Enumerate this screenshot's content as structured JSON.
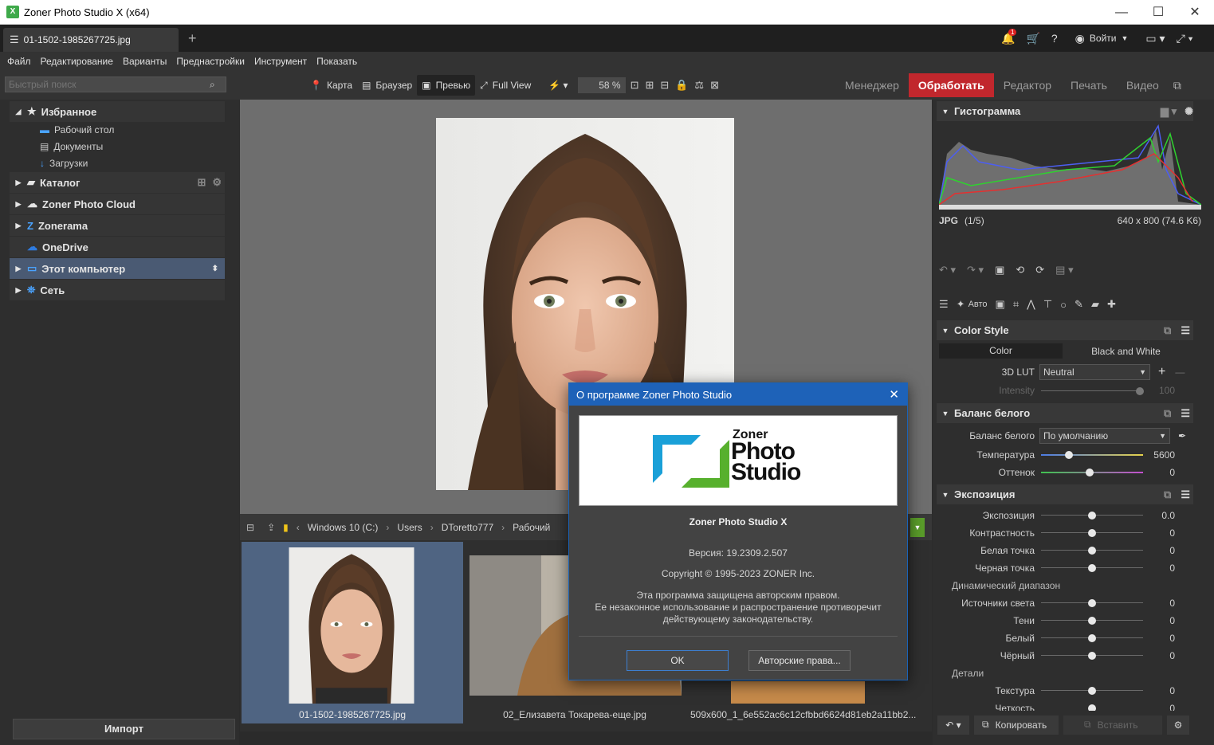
{
  "window": {
    "title": "Zoner Photo Studio X (x64)",
    "minimize": "—",
    "maximize": "☐",
    "close": "✕"
  },
  "tab": {
    "label": "01-1502-1985267725.jpg",
    "add": "+"
  },
  "topright": {
    "notif_count": "1",
    "help": "?",
    "login": "Войти"
  },
  "menu": [
    "Файл",
    "Редактирование",
    "Варианты",
    "Преднастройки",
    "Инструмент",
    "Показать"
  ],
  "search": {
    "placeholder": "Быстрый поиск"
  },
  "toolbar": {
    "map": "Карта",
    "browser": "Браузер",
    "preview": "Превью",
    "fullview": "Full View",
    "zoom": "58 %"
  },
  "modes": {
    "manager": "Менеджер",
    "develop": "Обработать",
    "editor": "Редактор",
    "print": "Печать",
    "video": "Видео"
  },
  "colors": {
    "accent_red": "#c1272d",
    "dialog_blue": "#1e62b8",
    "selected_row": "#4a5a73"
  },
  "nav": {
    "favorites": "Избранное",
    "fav_items": [
      "Рабочий стол",
      "Документы",
      "Загрузки"
    ],
    "catalog": "Каталог",
    "cloud": "Zoner Photo Cloud",
    "zonerama": "Zonerama",
    "onedrive": "OneDrive",
    "computer": "Этот компьютер",
    "network": "Сеть"
  },
  "import_label": "Импорт",
  "path": [
    "Windows 10 (C:)",
    "Users",
    "DToretto777",
    "Рабочий"
  ],
  "thumbs": [
    "01-1502-1985267725.jpg",
    "02_Елизавета Токарева-еще.jpg",
    "509x600_1_6e552ac6c12cfbbd6624d81eb2a11bb2..."
  ],
  "histogram": {
    "title": "Гистограмма",
    "format": "JPG",
    "index": "(1/5)",
    "dims": "640 x 800 (74.6 K6)"
  },
  "tools": {
    "auto": "Авто"
  },
  "colorstyle": {
    "title": "Color Style",
    "tab_color": "Color",
    "tab_bw": "Black and White",
    "lut_label": "3D LUT",
    "lut_value": "Neutral",
    "intensity_label": "Intensity",
    "intensity_value": "100"
  },
  "wb": {
    "title": "Баланс белого",
    "label": "Баланс белого",
    "value": "По умолчанию",
    "temp_label": "Температура",
    "temp_value": "5600",
    "tint_label": "Оттенок",
    "tint_value": "0"
  },
  "exposure": {
    "title": "Экспозиция",
    "rows": [
      {
        "label": "Экспозиция",
        "value": "0.0"
      },
      {
        "label": "Контрастность",
        "value": "0"
      },
      {
        "label": "Белая точка",
        "value": "0"
      },
      {
        "label": "Черная точка",
        "value": "0"
      }
    ],
    "dynamic_label": "Динамический диапазон",
    "dyn_rows": [
      {
        "label": "Источники света",
        "value": "0"
      },
      {
        "label": "Тени",
        "value": "0"
      },
      {
        "label": "Белый",
        "value": "0"
      },
      {
        "label": "Чёрный",
        "value": "0"
      }
    ],
    "details_label": "Детали",
    "detail_rows": [
      {
        "label": "Текстура",
        "value": "0"
      },
      {
        "label": "Четкость",
        "value": "0"
      }
    ]
  },
  "bottombar": {
    "copy": "Копировать",
    "paste": "Вставить"
  },
  "dialog": {
    "title": "О программе Zoner Photo Studio",
    "logo_line1": "Zoner",
    "logo_line2": "Photo",
    "logo_line3": "Studio",
    "product": "Zoner Photo Studio X",
    "version": "Версия: 19.2309.2.507",
    "copyright": "Copyright © 1995-2023 ZONER Inc.",
    "legal1": "Эта программа защищена авторским правом.",
    "legal2": "Ее незаконное использование и распространение противоречит",
    "legal3": "действующему законодательству.",
    "ok": "OK",
    "rights": "Авторские права..."
  }
}
